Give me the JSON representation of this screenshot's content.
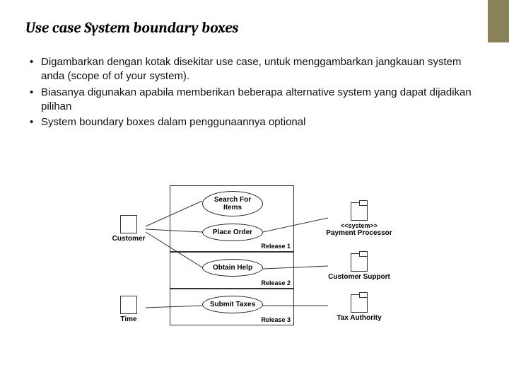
{
  "title": "Use case System boundary boxes",
  "bullets": [
    "Digambarkan dengan kotak disekitar use case, untuk menggambarkan jangkauan system anda (scope of of your system).",
    "Biasanya digunakan apabila memberikan beberapa alternative system yang dapat dijadikan pilihan",
    "System boundary boxes dalam penggunaannya optional"
  ],
  "diagram": {
    "actors": {
      "customer": "Customer",
      "time": "Time",
      "payment": "Payment Processor",
      "payment_stereotype": "<<system>>",
      "support": "Customer Support",
      "tax": "Tax Authority"
    },
    "usecases": {
      "search": "Search For Items",
      "place": "Place Order",
      "help": "Obtain Help",
      "taxes": "Submit Taxes"
    },
    "boundaries": {
      "r1": "Release 1",
      "r2": "Release 2",
      "r3": "Release 3"
    }
  }
}
